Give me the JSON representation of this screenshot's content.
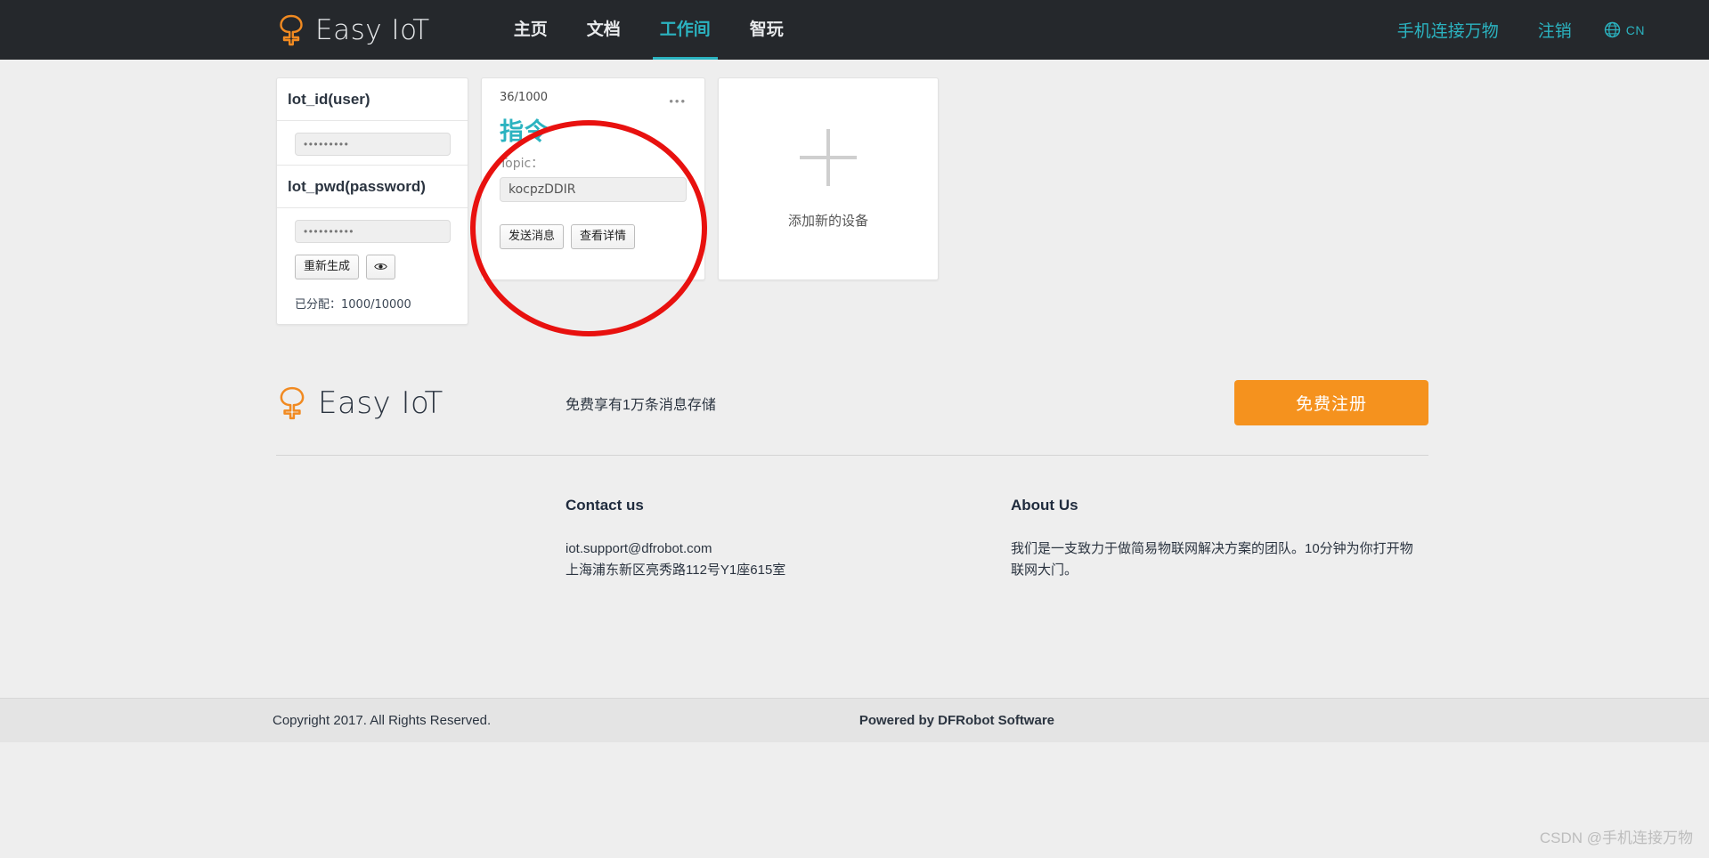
{
  "navbar": {
    "brand": "Easy IoT",
    "logo_icon": "tree-logo-icon",
    "links": [
      {
        "label": "主页",
        "active": false
      },
      {
        "label": "文档",
        "active": false
      },
      {
        "label": "工作间",
        "active": true
      },
      {
        "label": "智玩",
        "active": false
      }
    ],
    "right_links": [
      {
        "label": "手机连接万物"
      },
      {
        "label": "注销"
      }
    ],
    "language": {
      "icon": "globe-icon",
      "code": "CN"
    },
    "bg_color": "#25282c",
    "accent_color": "#2bb3c0"
  },
  "workspace": {
    "credentials": {
      "user_header": "lot_id(user)",
      "user_value": "•••••••••",
      "user_placeholder": "",
      "pwd_header": "lot_pwd(password)",
      "pwd_value": "••••••••••",
      "pwd_placeholder": "",
      "regenerate_label": "重新生成",
      "toggle_icon": "eye-icon",
      "allocation": "已分配：1000/10000"
    },
    "topic_card": {
      "count": "36/1000",
      "menu_icon": "ellipsis-icon",
      "title": "指令",
      "topic_label": "Topic：",
      "topic_value": "kocpzDDIR",
      "send_label": "发送消息",
      "detail_label": "查看详情",
      "title_color": "#2bb3c0"
    },
    "add_card": {
      "plus_icon": "plus-icon",
      "label": "添加新的设备"
    },
    "annotation": {
      "shape": "red-ellipse-highlight",
      "color": "#e8110f"
    }
  },
  "promo": {
    "brand": "Easy IoT",
    "logo_icon": "tree-logo-icon",
    "note": "免费享有1万条消息存储",
    "register_label": "免费注册",
    "register_color": "#f5921e"
  },
  "footer": {
    "columns": [
      {
        "heading": "Contact us",
        "line1": "iot.support@dfrobot.com",
        "line2": "上海浦东新区亮秀路112号Y1座615室"
      },
      {
        "heading": "About Us",
        "line1": "我们是一支致力于做简易物联网解决方案的团队。10分钟为你打开物联网大门。",
        "line2": ""
      }
    ],
    "copyright": "Copyright 2017. All Rights Reserved.",
    "powered_by": "Powered by DFRobot Software"
  },
  "watermark": "CSDN @手机连接万物"
}
